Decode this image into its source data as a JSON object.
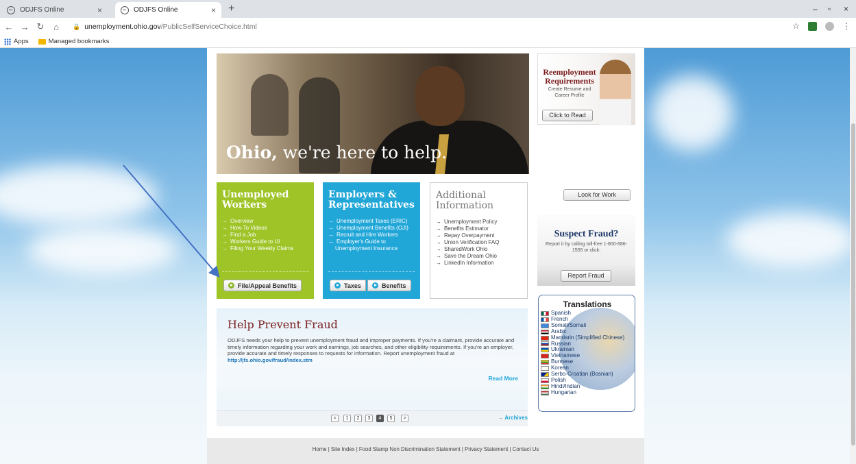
{
  "browser": {
    "tabs": [
      {
        "label": "ODJFS Online",
        "close": "×"
      },
      {
        "label": "ODJFS Online",
        "close": "×"
      }
    ],
    "new_tab": "+",
    "window_controls": {
      "minimize": "–",
      "restore": "▫",
      "close": "×"
    },
    "url_domain": "unemployment.ohio.gov",
    "url_path": "/PublicSelfServiceChoice.html",
    "bookmarks": [
      "Apps",
      "Managed bookmarks"
    ]
  },
  "hero": {
    "bold": "Ohio,",
    "rest": " we're here to help."
  },
  "reemployment": {
    "title": "Reemployment Requirements",
    "subtitle": "Create Resume and Career Profile",
    "button": "Click to Read"
  },
  "unemployed": {
    "title": "Unemployed Workers",
    "links": [
      "Overview",
      "How-To Videos",
      "Find a Job",
      "Workers Guide to UI",
      "Filing Your Weekly Claims"
    ],
    "button": "File/Appeal Benefits"
  },
  "employers": {
    "title": "Employers & Representatives",
    "links": [
      "Unemployment Taxes (ERIC)",
      "Unemployment Benefits (OJI)",
      "Recruit and Hire Workers",
      "Employer's Guide to",
      "Unemployment Insurance"
    ],
    "button_taxes": "Taxes",
    "button_benefits": "Benefits"
  },
  "additional": {
    "title": "Additional Information",
    "links": [
      "Unemployment Policy",
      "Benefits Estimator",
      "Repay Overpayment",
      "Union Verification FAQ",
      "SharedWork Ohio",
      "Save the Dream Ohio",
      "LinkedIn Information"
    ]
  },
  "look_for_work": "Look for Work",
  "suspect_fraud": {
    "title": "Suspect Fraud?",
    "text": "Report it by calling toll-free 1-800-686-1555 or click:",
    "button": "Report Fraud"
  },
  "translations": {
    "title": "Translations",
    "languages": [
      "Spanish",
      "French",
      "Somali/Somali",
      "Arabic",
      "Mandarin (Simplified Chinese)",
      "Russian",
      "Ukrainian",
      "Vietnamese",
      "Burmese",
      "Korean",
      "Serbo-Croatian (Bosnian)",
      "Polish",
      "Hindi/Indian",
      "Hungarian"
    ]
  },
  "help_fraud": {
    "title": "Help Prevent Fraud",
    "body": "ODJFS needs your help to prevent unemployment fraud and improper payments. If you're a claimant, provide accurate and timely information regarding your work and earnings, job searches, and other eligibility requirements. If you're an employer, provide accurate and timely responses to requests for information. Report unemployment fraud at ",
    "link": "http://jfs.ohio.gov/fraud/index.stm",
    "read_more": "Read More"
  },
  "pager": {
    "prev": "<",
    "pages": [
      "1",
      "2",
      "3",
      "4",
      "5"
    ],
    "current": "4",
    "next": ">",
    "archives": "Archives"
  },
  "footer": "Home | Site Index | Food Stamp Non Discrimination Statement | Privacy Statement | Contact Us",
  "colors": {
    "unemployed": "#9ec427",
    "employers": "#21a6d8",
    "fraud_title": "#7a1e1e",
    "annotation_arrow": "#4472c4"
  }
}
